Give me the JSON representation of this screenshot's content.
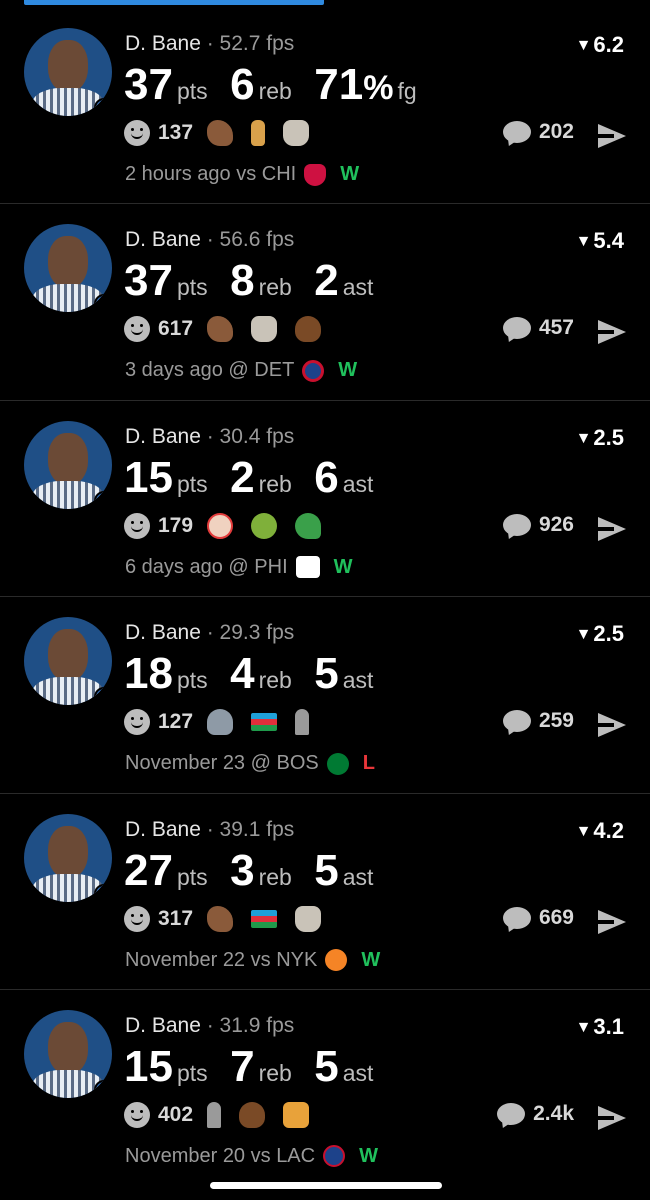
{
  "colors": {
    "accent": "#2f8ae0",
    "win": "#20c05c",
    "loss": "#e8363a",
    "background": "#000000"
  },
  "posts": [
    {
      "player": "D. Bane",
      "fps": "· 52.7 fps",
      "score": "6.2",
      "stats": [
        {
          "value": "37",
          "unit": "pts"
        },
        {
          "value": "6",
          "unit": "reb"
        },
        {
          "value": "71",
          "unit": "%",
          "suffix": "fg"
        }
      ],
      "reactions_count": "137",
      "emojis": [
        "dino",
        "finger",
        "goat"
      ],
      "comments": "202",
      "time": "2 hours ago",
      "venue": "vs",
      "team": "CHI",
      "team_logo": "chi",
      "result": "W"
    },
    {
      "player": "D. Bane",
      "fps": "· 56.6 fps",
      "score": "5.4",
      "stats": [
        {
          "value": "37",
          "unit": "pts"
        },
        {
          "value": "8",
          "unit": "reb"
        },
        {
          "value": "2",
          "unit": "ast"
        }
      ],
      "reactions_count": "617",
      "emojis": [
        "dino",
        "goat",
        "poop"
      ],
      "comments": "457",
      "time": "3 days ago",
      "venue": "@",
      "team": "DET",
      "team_logo": "det",
      "result": "W"
    },
    {
      "player": "D. Bane",
      "fps": "· 30.4 fps",
      "score": "2.5",
      "stats": [
        {
          "value": "15",
          "unit": "pts"
        },
        {
          "value": "2",
          "unit": "reb"
        },
        {
          "value": "6",
          "unit": "ast"
        }
      ],
      "reactions_count": "179",
      "emojis": [
        "clown",
        "apple",
        "clover"
      ],
      "comments": "926",
      "time": "6 days ago",
      "venue": "@",
      "team": "PHI",
      "team_logo": "phi",
      "result": "W"
    },
    {
      "player": "D. Bane",
      "fps": "· 29.3 fps",
      "score": "2.5",
      "stats": [
        {
          "value": "18",
          "unit": "pts"
        },
        {
          "value": "4",
          "unit": "reb"
        },
        {
          "value": "5",
          "unit": "ast"
        }
      ],
      "reactions_count": "127",
      "emojis": [
        "storm",
        "flag-az",
        "cane"
      ],
      "comments": "259",
      "time": "November 23",
      "venue": "@",
      "team": "BOS",
      "team_logo": "bos",
      "result": "L"
    },
    {
      "player": "D. Bane",
      "fps": "· 39.1 fps",
      "score": "4.2",
      "stats": [
        {
          "value": "27",
          "unit": "pts"
        },
        {
          "value": "3",
          "unit": "reb"
        },
        {
          "value": "5",
          "unit": "ast"
        }
      ],
      "reactions_count": "317",
      "emojis": [
        "dino",
        "flag-az",
        "goat"
      ],
      "comments": "669",
      "time": "November 22",
      "venue": "vs",
      "team": "NYK",
      "team_logo": "nyk",
      "result": "W"
    },
    {
      "player": "D. Bane",
      "fps": "· 31.9 fps",
      "score": "3.1",
      "stats": [
        {
          "value": "15",
          "unit": "pts"
        },
        {
          "value": "7",
          "unit": "reb"
        },
        {
          "value": "5",
          "unit": "ast"
        }
      ],
      "reactions_count": "402",
      "emojis": [
        "cane",
        "poop",
        "kiss"
      ],
      "comments": "2.4k",
      "time": "November 20",
      "venue": "vs",
      "team": "LAC",
      "team_logo": "lac",
      "result": "W"
    }
  ]
}
